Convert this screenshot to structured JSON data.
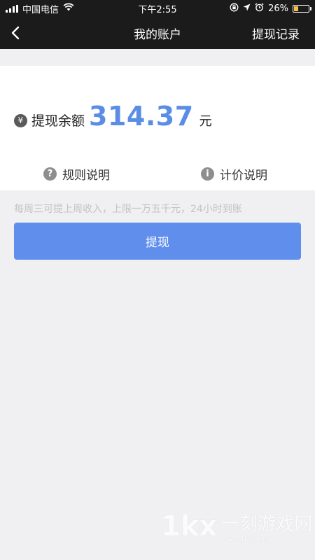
{
  "status_bar": {
    "carrier": "中国电信",
    "time": "下午2:55",
    "battery_percent": "26%",
    "battery_level": 0.26,
    "icons": [
      "signal-icon",
      "wifi-icon",
      "orientation-lock-icon",
      "location-arrow-icon",
      "alarm-icon",
      "battery-icon"
    ]
  },
  "navbar": {
    "title": "我的账户",
    "right_action": "提现记录",
    "back_icon": "chevron-left-icon",
    "bg_color": "#1b1b1c"
  },
  "balance": {
    "icon_glyph": "¥",
    "label": "提现余额",
    "amount": "314.37",
    "unit": "元",
    "amount_color": "#5a8ee6"
  },
  "links": [
    {
      "icon_glyph": "?",
      "icon": "question-circle-icon",
      "label": "规则说明"
    },
    {
      "icon_glyph": "i",
      "icon": "info-circle-icon",
      "label": "计价说明"
    }
  ],
  "hint": "每周三可提上周收入，上限一万五千元，24小时到账",
  "withdraw_button": {
    "label": "提现",
    "color": "#5f8eed"
  },
  "watermark": {
    "logo": "1kx",
    "name": "一刻游戏网",
    "url": "www.1kyx.com"
  }
}
